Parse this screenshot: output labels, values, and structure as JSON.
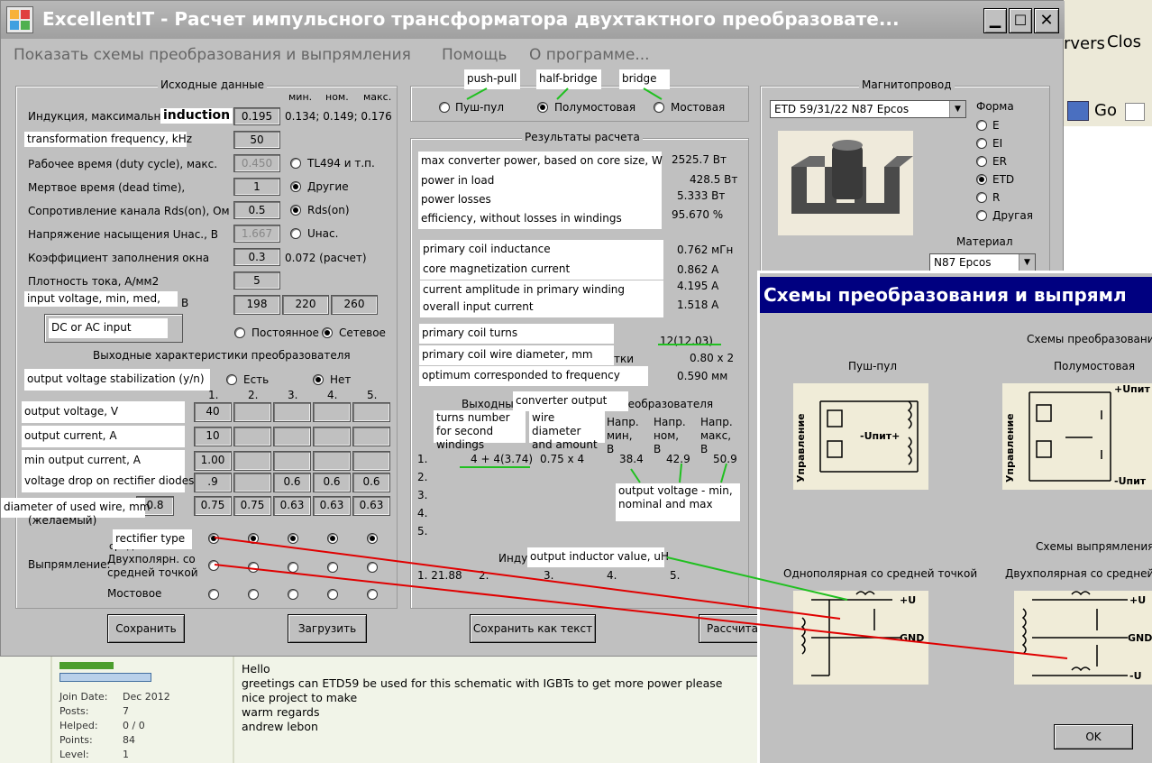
{
  "app": {
    "title": "ExcellentIT - Расчет импульсного трансформатора двухтактного преобразовате...",
    "menu": [
      "Показать схемы преобразования и выпрямления",
      "Помощь",
      "О программе..."
    ]
  },
  "behind": {
    "servers": "rvers",
    "close": "Clos",
    "go": "Go"
  },
  "input": {
    "legend": "Исходные данные",
    "col_min": "мин.",
    "col_nom": "ном.",
    "col_max": "макс.",
    "induction_label": "Индукция, максимальная",
    "induction_note": "induction",
    "induction_value": "0.195",
    "induction_range": "0.134; 0.149; 0.176",
    "freq_label": "transformation frequency, kHz",
    "freq_value": "50",
    "duty_label": "Рабочее время (duty cycle), макс.",
    "duty_value": "0.450",
    "duty_opt": "TL494 и т.п.",
    "dead_label": "Мертвое время (dead time),",
    "dead_value": "1",
    "dead_opt": "Другие",
    "rds_label": "Сопротивление канала Rds(on), Ом",
    "rds_value": "0.5",
    "rds_opt": "Rds(on)",
    "usat_label": "Напряжение насыщения Uнас., В",
    "usat_value": "1.667",
    "usat_opt": "Uнас.",
    "fill_label": "Коэффициент заполнения окна",
    "fill_value": "0.3",
    "fill_calc": "0.072 (расчет)",
    "dens_label": "Плотность тока, А/мм2",
    "dens_value": "5",
    "vin_label": "input voltage, min, med,",
    "vin_unit": "В",
    "vin_min": "198",
    "vin_med": "220",
    "vin_max": "260",
    "dcac_note": "DC or AC input",
    "dc_opt": "Постоянное",
    "ac_opt": "Сетевое"
  },
  "output": {
    "legend": "Выходные характеристики преобразователя",
    "stab_label": "output voltage stabilization (y/n)",
    "stab_yes": "Есть",
    "stab_no": "Нет",
    "cols": [
      "1.",
      "2.",
      "3.",
      "4.",
      "5."
    ],
    "rows": [
      {
        "label": "output voltage, V",
        "cells": [
          "40",
          "",
          "",
          "",
          ""
        ]
      },
      {
        "label": "output current, A",
        "cells": [
          "10",
          "",
          "",
          "",
          ""
        ]
      },
      {
        "label": "min output current, A",
        "cells": [
          "1.00",
          "",
          "",
          "",
          ""
        ]
      },
      {
        "label": "voltage drop on rectifier diodes",
        "cells": [
          ".9",
          "",
          "0.6",
          "0.6",
          "0.6"
        ]
      },
      {
        "label": "diameter of used wire, mm",
        "cells": [
          "0.75",
          "0.75",
          "0.63",
          "0.63",
          "0.63"
        ]
      }
    ],
    "wire_extra": "0.8",
    "wish": "(желаемый)",
    "rect_note": "rectifier type",
    "rect_mid": "средней точкой",
    "rect_label": "Выпрямление:",
    "rect_bip": "Двухполярн. со",
    "rect_bip2": "средней точкой",
    "rect_bridge": "Мостовое"
  },
  "topology": {
    "pushpull_note": "push-pull",
    "halfbridge_note": "half-bridge",
    "bridge_note": "bridge",
    "pushpull": "Пуш-пул",
    "halfbridge": "Полумостовая",
    "bridge": "Мостовая"
  },
  "results": {
    "legend": "Результаты расчета",
    "items": [
      {
        "label": "max converter power, based on core size, W",
        "value": "2525.7 Вт"
      },
      {
        "label": "power in load",
        "value": "428.5 Вт"
      },
      {
        "label": "power losses",
        "value": "5.333 Вт"
      },
      {
        "label": "efficiency, without losses in windings",
        "value": "95.670 %"
      }
    ],
    "items2": [
      {
        "label": "primary coil inductance",
        "value": "0.762 мГн"
      },
      {
        "label": "core magnetization current",
        "value": "0.862 А"
      },
      {
        "label": "current amplitude in primary winding",
        "value": "4.195 А"
      },
      {
        "label": "overall input current",
        "value": "1.518 А"
      }
    ],
    "turns_label": "primary coil turns",
    "turns_value": "12(12.03)",
    "pwire_label": "primary coil wire diameter, mm",
    "pwire_value": "0.80 x 2",
    "pwire_hidden": "тки",
    "opt_label": "optimum corresponded to frequency",
    "opt_value": "0.590 мм",
    "out_title_a": "Выходные",
    "out_title_b": "реобразователя",
    "conv_note": "converter output",
    "wire_note": "wire diameter and amount",
    "turns_note": "turns number for second windings",
    "h_min": "Напр. мин, В",
    "h_nom": "Напр. ном, В",
    "h_max": "Напр. макс, В",
    "row_nums": [
      "1.",
      "2.",
      "3.",
      "4.",
      "5."
    ],
    "r1_turns": "4 + 4(3.74)",
    "r1_wire": "0.75 x 4",
    "r1_min": "38.4",
    "r1_nom": "42.9",
    "r1_max": "50.9",
    "outv_note": "output voltage - min, nominal and max",
    "ind_a": "Индук",
    "ind_note": "output inductor value, uH",
    "ind_row": [
      "1. 21.88",
      "2.",
      "3.",
      "4.",
      "5."
    ]
  },
  "core": {
    "legend": "Магнитопровод",
    "selected": "ETD 59/31/22 N87 Epcos",
    "shape_label": "Форма",
    "shapes": [
      "E",
      "EI",
      "ER",
      "ETD",
      "R",
      "Другая"
    ],
    "material_label": "Материал",
    "material": "N87 Epcos"
  },
  "buttons": {
    "save": "Сохранить",
    "load": "Загрузить",
    "save_text": "Сохранить как текст",
    "calc": "Рассчитать"
  },
  "forum": {
    "lbl_join": "Join Date:",
    "val_join": "Dec 2012",
    "lbl_posts": "Posts:",
    "val_posts": "7",
    "lbl_helped": "Helped:",
    "val_helped": "0 / 0",
    "lbl_points": "Points:",
    "val_points": "84",
    "lbl_level": "Level:",
    "val_level": "1",
    "lines": [
      "Hello",
      "greetings can ETD59 be used for this schematic with IGBTs to get more power please",
      "nice project to make",
      "warm regards",
      "andrew lebon"
    ]
  },
  "schemes": {
    "title": "Схемы преобразования и выпрямл",
    "conv_title": "Схемы  преобразования",
    "pp": "Пуш-пул",
    "hb": "Полумостовая",
    "ctrl": "Управление",
    "upit": "-Uпит+",
    "upit_p": "+Uпит",
    "upit_m": "-Uпит",
    "rect_title": "Схемы выпрямления:",
    "uni": "Однополярная со средней точкой",
    "bip": "Двухполярная со средней то",
    "plus_u": "+U",
    "gnd": "GND",
    "minus_u": "-U",
    "ok": "OK"
  }
}
